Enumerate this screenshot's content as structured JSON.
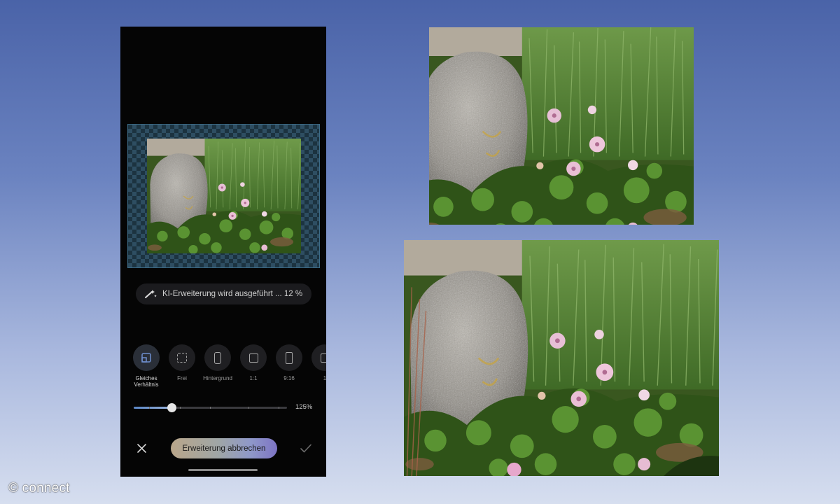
{
  "editor": {
    "progress_text": "KI-Erweiterung wird ausgeführt ... 12 %",
    "ratio_options": [
      {
        "label": "Gleiches Verhältnis",
        "icon": "same-ratio-icon",
        "active": true
      },
      {
        "label": "Frei",
        "icon": "free-crop-icon",
        "active": false
      },
      {
        "label": "Hintergrund",
        "icon": "phone-background-icon",
        "active": false
      },
      {
        "label": "1:1",
        "icon": "square-icon",
        "active": false
      },
      {
        "label": "9:16",
        "icon": "portrait-icon",
        "active": false
      },
      {
        "label": "1",
        "icon": "ratio-icon",
        "active": false
      }
    ],
    "zoom": {
      "value": 125,
      "label": "125%",
      "slider_fraction": 0.25
    },
    "cancel_label": "Erweiterung abbrechen",
    "close_icon": "close-icon",
    "confirm_icon": "check-icon",
    "accent_color": "#6e8fcf"
  },
  "watermark": "© connect"
}
